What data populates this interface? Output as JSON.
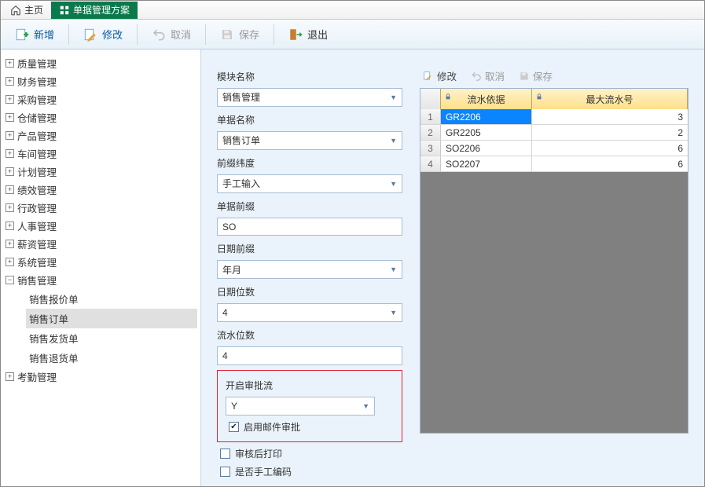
{
  "tabs": {
    "home": "主页",
    "active": "单据管理方案"
  },
  "toolbar": {
    "new": "新增",
    "edit": "修改",
    "cancel": "取消",
    "save": "保存",
    "exit": "退出"
  },
  "tree": {
    "nodes": [
      "质量管理",
      "财务管理",
      "采购管理",
      "仓储管理",
      "产品管理",
      "车间管理",
      "计划管理",
      "绩效管理",
      "行政管理",
      "人事管理",
      "薪资管理",
      "系统管理"
    ],
    "expanded_label": "销售管理",
    "expanded_children": [
      "销售报价单",
      "销售订单",
      "销售发货单",
      "销售退货单"
    ],
    "selected_child": "销售订单",
    "last": "考勤管理"
  },
  "form": {
    "module_label": "模块名称",
    "module_value": "销售管理",
    "bill_label": "单据名称",
    "bill_value": "销售订单",
    "prefix_dim_label": "前缀纬度",
    "prefix_dim_value": "手工输入",
    "bill_prefix_label": "单据前缀",
    "bill_prefix_value": "SO",
    "date_prefix_label": "日期前缀",
    "date_prefix_value": "年月",
    "date_digits_label": "日期位数",
    "date_digits_value": "4",
    "serial_digits_label": "流水位数",
    "serial_digits_value": "4",
    "approval_label": "开启审批流",
    "approval_value": "Y",
    "email_approval": "启用邮件审批",
    "print_after_audit": "审核后打印",
    "manual_code": "是否手工编码"
  },
  "right": {
    "edit": "修改",
    "cancel": "取消",
    "save": "保存",
    "col_serial": "流水依据",
    "col_max": "最大流水号",
    "rows": [
      {
        "n": "1",
        "a": "GR2206",
        "b": "3"
      },
      {
        "n": "2",
        "a": "GR2205",
        "b": "2"
      },
      {
        "n": "3",
        "a": "SO2206",
        "b": "6"
      },
      {
        "n": "4",
        "a": "SO2207",
        "b": "6"
      }
    ]
  }
}
